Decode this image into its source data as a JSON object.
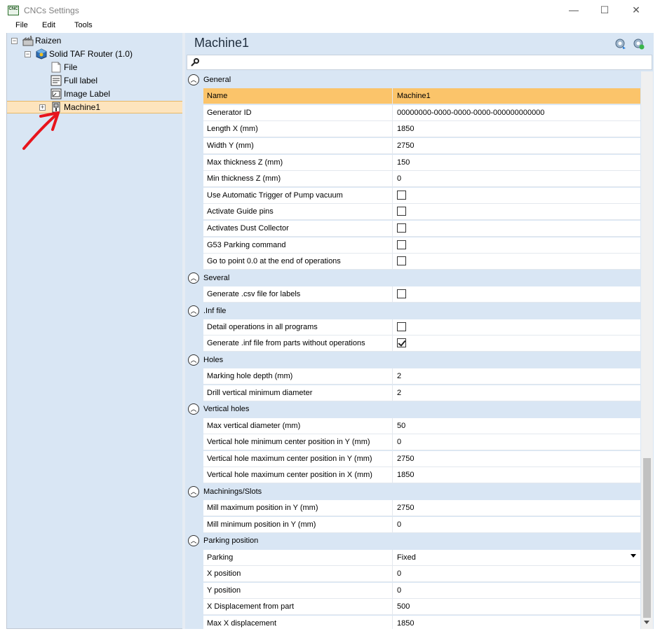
{
  "window": {
    "title": "CNCs Settings",
    "icon_text": "CNC",
    "min": "—",
    "max": "☐",
    "close": "✕"
  },
  "menu": [
    "File",
    "Edit",
    "Tools"
  ],
  "tree": {
    "root": "Raizen",
    "router": "Solid TAF Router (1.0)",
    "file": "File",
    "full_label": "Full label",
    "image_label": "Image Label",
    "machine": "Machine1"
  },
  "panel": {
    "title": "Machine1"
  },
  "categories": [
    {
      "label": "General",
      "rows": [
        {
          "name": "Name",
          "value": "Machine1",
          "selected": true
        },
        {
          "name": "Generator ID",
          "value": "00000000-0000-0000-0000-000000000000"
        },
        {
          "name": "Length X (mm)",
          "value": "1850"
        },
        {
          "name": "Width Y (mm)",
          "value": "2750"
        },
        {
          "name": "Max thickness Z (mm)",
          "value": "150"
        },
        {
          "name": "Min thickness Z (mm)",
          "value": "0"
        },
        {
          "name": "Use Automatic Trigger of Pump vacuum",
          "checkbox": true,
          "checked": false
        },
        {
          "name": "Activate Guide pins",
          "checkbox": true,
          "checked": false
        },
        {
          "name": "Activates Dust Collector",
          "checkbox": true,
          "checked": false
        },
        {
          "name": "G53 Parking command",
          "checkbox": true,
          "checked": false
        },
        {
          "name": "Go to point 0.0 at the end of operations",
          "checkbox": true,
          "checked": false
        }
      ]
    },
    {
      "label": "Several",
      "rows": [
        {
          "name": "Generate .csv file for labels",
          "checkbox": true,
          "checked": false
        }
      ]
    },
    {
      "label": ".Inf file",
      "rows": [
        {
          "name": "Detail operations in all programs",
          "checkbox": true,
          "checked": false
        },
        {
          "name": "Generate .inf file from parts without operations",
          "checkbox": true,
          "checked": true
        }
      ]
    },
    {
      "label": "Holes",
      "rows": [
        {
          "name": "Marking hole depth (mm)",
          "value": "2"
        },
        {
          "name": "Drill vertical minimum diameter",
          "value": "2"
        }
      ]
    },
    {
      "label": "Vertical holes",
      "rows": [
        {
          "name": "Max vertical diameter (mm)",
          "value": "50"
        },
        {
          "name": "Vertical hole minimum center position in Y (mm)",
          "value": "0"
        },
        {
          "name": "Vertical hole maximum center position in Y (mm)",
          "value": "2750"
        },
        {
          "name": "Vertical hole maximum center position in X (mm)",
          "value": "1850"
        }
      ]
    },
    {
      "label": "Machinings/Slots",
      "rows": [
        {
          "name": "Mill maximum position in Y (mm)",
          "value": "2750"
        },
        {
          "name": "Mill minimum position in Y (mm)",
          "value": "0"
        }
      ]
    },
    {
      "label": "Parking position",
      "rows": [
        {
          "name": "Parking",
          "value": "Fixed",
          "dropdown": true
        },
        {
          "name": "X position",
          "value": "0"
        },
        {
          "name": "Y position",
          "value": "0"
        },
        {
          "name": "X Displacement from part",
          "value": "500"
        },
        {
          "name": "Max X displacement",
          "value": "1850"
        }
      ]
    }
  ],
  "colors": {
    "selected_row": "#fbc46a",
    "tree_selection": "#fde4bd",
    "panel_bg": "#d9e6f4",
    "annotation_arrow": "#e8141c"
  }
}
